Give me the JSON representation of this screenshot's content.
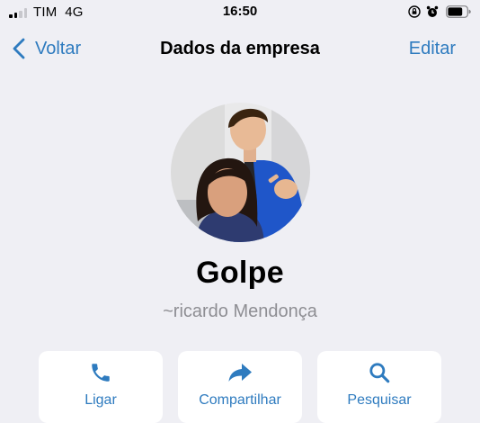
{
  "status_bar": {
    "carrier": "TIM",
    "network": "4G",
    "time": "16:50",
    "icons": [
      "signal-icon",
      "orientation-lock-icon",
      "alarm-icon",
      "battery-icon"
    ],
    "battery_level": 0.75
  },
  "nav": {
    "back_label": "Voltar",
    "title": "Dados da empresa",
    "edit_label": "Editar"
  },
  "profile": {
    "name": "Golpe",
    "subtitle": "~ricardo Mendonça"
  },
  "actions": [
    {
      "label": "Ligar",
      "icon": "phone-icon"
    },
    {
      "label": "Compartilhar",
      "icon": "share-arrow-icon"
    },
    {
      "label": "Pesquisar",
      "icon": "search-icon"
    }
  ],
  "colors": {
    "accent": "#2e7bbf",
    "background": "#efeff4",
    "card": "#ffffff",
    "secondary_text": "#8e8e93"
  }
}
